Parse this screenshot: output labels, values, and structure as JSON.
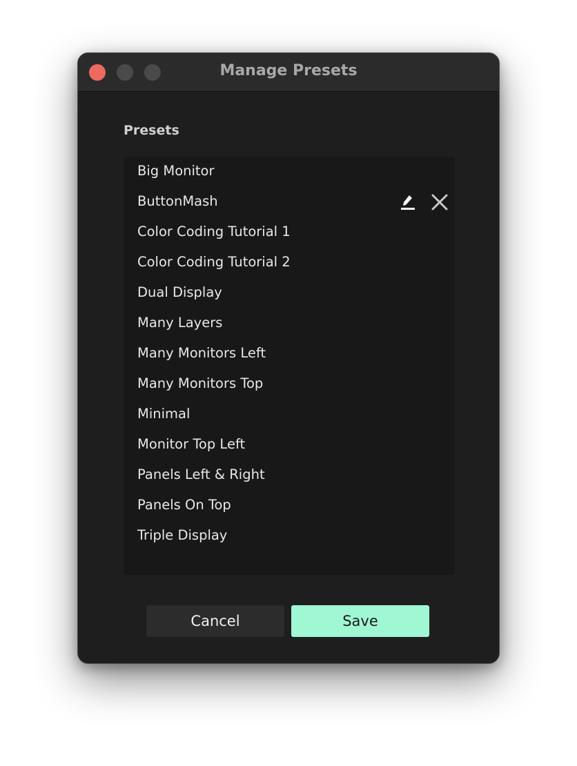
{
  "window": {
    "title": "Manage Presets"
  },
  "section": {
    "label": "Presets"
  },
  "presets": [
    {
      "label": "Big Monitor"
    },
    {
      "label": "ButtonMash",
      "hovered": true
    },
    {
      "label": "Color Coding Tutorial 1"
    },
    {
      "label": "Color Coding Tutorial 2"
    },
    {
      "label": "Dual Display"
    },
    {
      "label": "Many Layers"
    },
    {
      "label": "Many Monitors Left"
    },
    {
      "label": "Many Monitors Top"
    },
    {
      "label": "Minimal"
    },
    {
      "label": "Monitor Top Left"
    },
    {
      "label": "Panels Left & Right"
    },
    {
      "label": "Panels On Top"
    },
    {
      "label": "Triple Display"
    }
  ],
  "row_icons": {
    "edit": "pencil-icon",
    "delete": "close-icon"
  },
  "footer": {
    "cancel_label": "Cancel",
    "save_label": "Save"
  },
  "colors": {
    "accent": "#9ff7d4",
    "close_light": "#ed6a5e",
    "window_bg": "#1e1e1e",
    "list_bg": "#181818"
  }
}
